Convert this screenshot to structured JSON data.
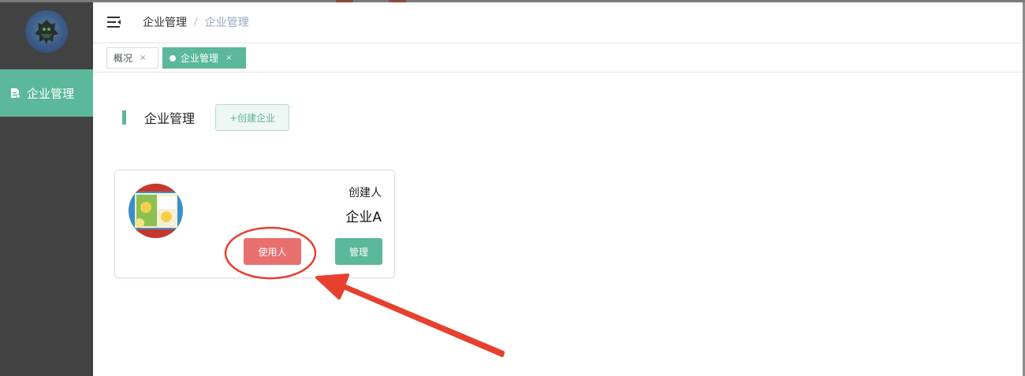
{
  "colors": {
    "accent": "#5bb89a",
    "sidebar_bg": "#424242",
    "danger": "#e8706f",
    "annotation": "#e8402f"
  },
  "sidebar": {
    "logo_icon": "robot-avatar-icon",
    "items": [
      {
        "label": "企业管理",
        "icon": "document-icon",
        "active": true
      }
    ]
  },
  "header": {
    "menu_icon": "hamburger-icon",
    "breadcrumb": [
      "企业管理",
      "企业管理"
    ],
    "separator": "/"
  },
  "tags": [
    {
      "label": "概况",
      "active": false,
      "close": "×"
    },
    {
      "label": "企业管理",
      "active": true,
      "close": "×"
    }
  ],
  "main": {
    "section_title": "企业管理",
    "create_button": "+创建企业",
    "cards": [
      {
        "creator_label": "创建人",
        "company_name": "企业A",
        "users_button": "使用人",
        "manage_button": "管理"
      }
    ]
  }
}
